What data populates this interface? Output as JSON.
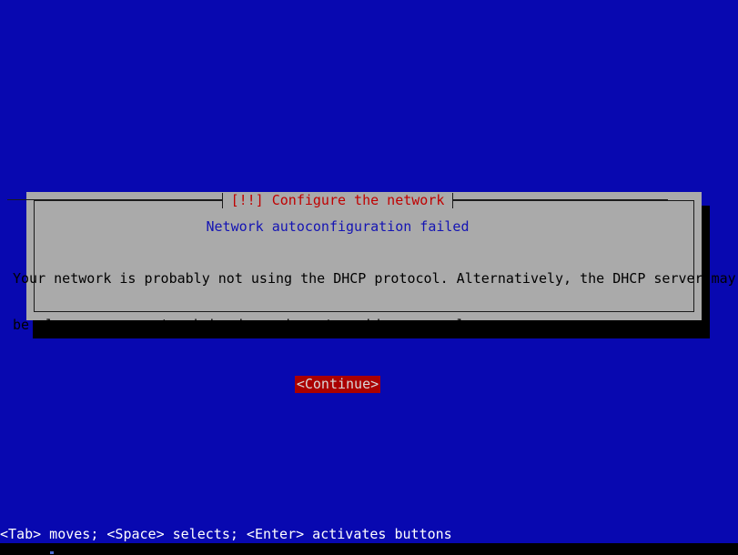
{
  "screen": {
    "background_color": "#0808b0",
    "bottom_strip_color": "#000000"
  },
  "dialog": {
    "title": "[!!] Configure the network",
    "title_color": "#c00000",
    "background_color": "#aaaaaa",
    "border_color": "#1b1b1b",
    "shadow_color": "#000000",
    "headline": "Network autoconfiguration failed",
    "headline_color": "#1414b4",
    "paragraph_lines": [
      "Your network is probably not using the DHCP protocol. Alternatively, the DHCP server may",
      "be slow or some network hardware is not working properly."
    ],
    "paragraph_color": "#000000",
    "button": {
      "label": "<Continue>",
      "background_color": "#aa0000",
      "text_color": "#d9d9d9",
      "focused": true
    }
  },
  "status_bar": {
    "text": "<Tab> moves; <Space> selects; <Enter> activates buttons",
    "background_color": "#0808b0",
    "text_color": "#ffffff"
  }
}
